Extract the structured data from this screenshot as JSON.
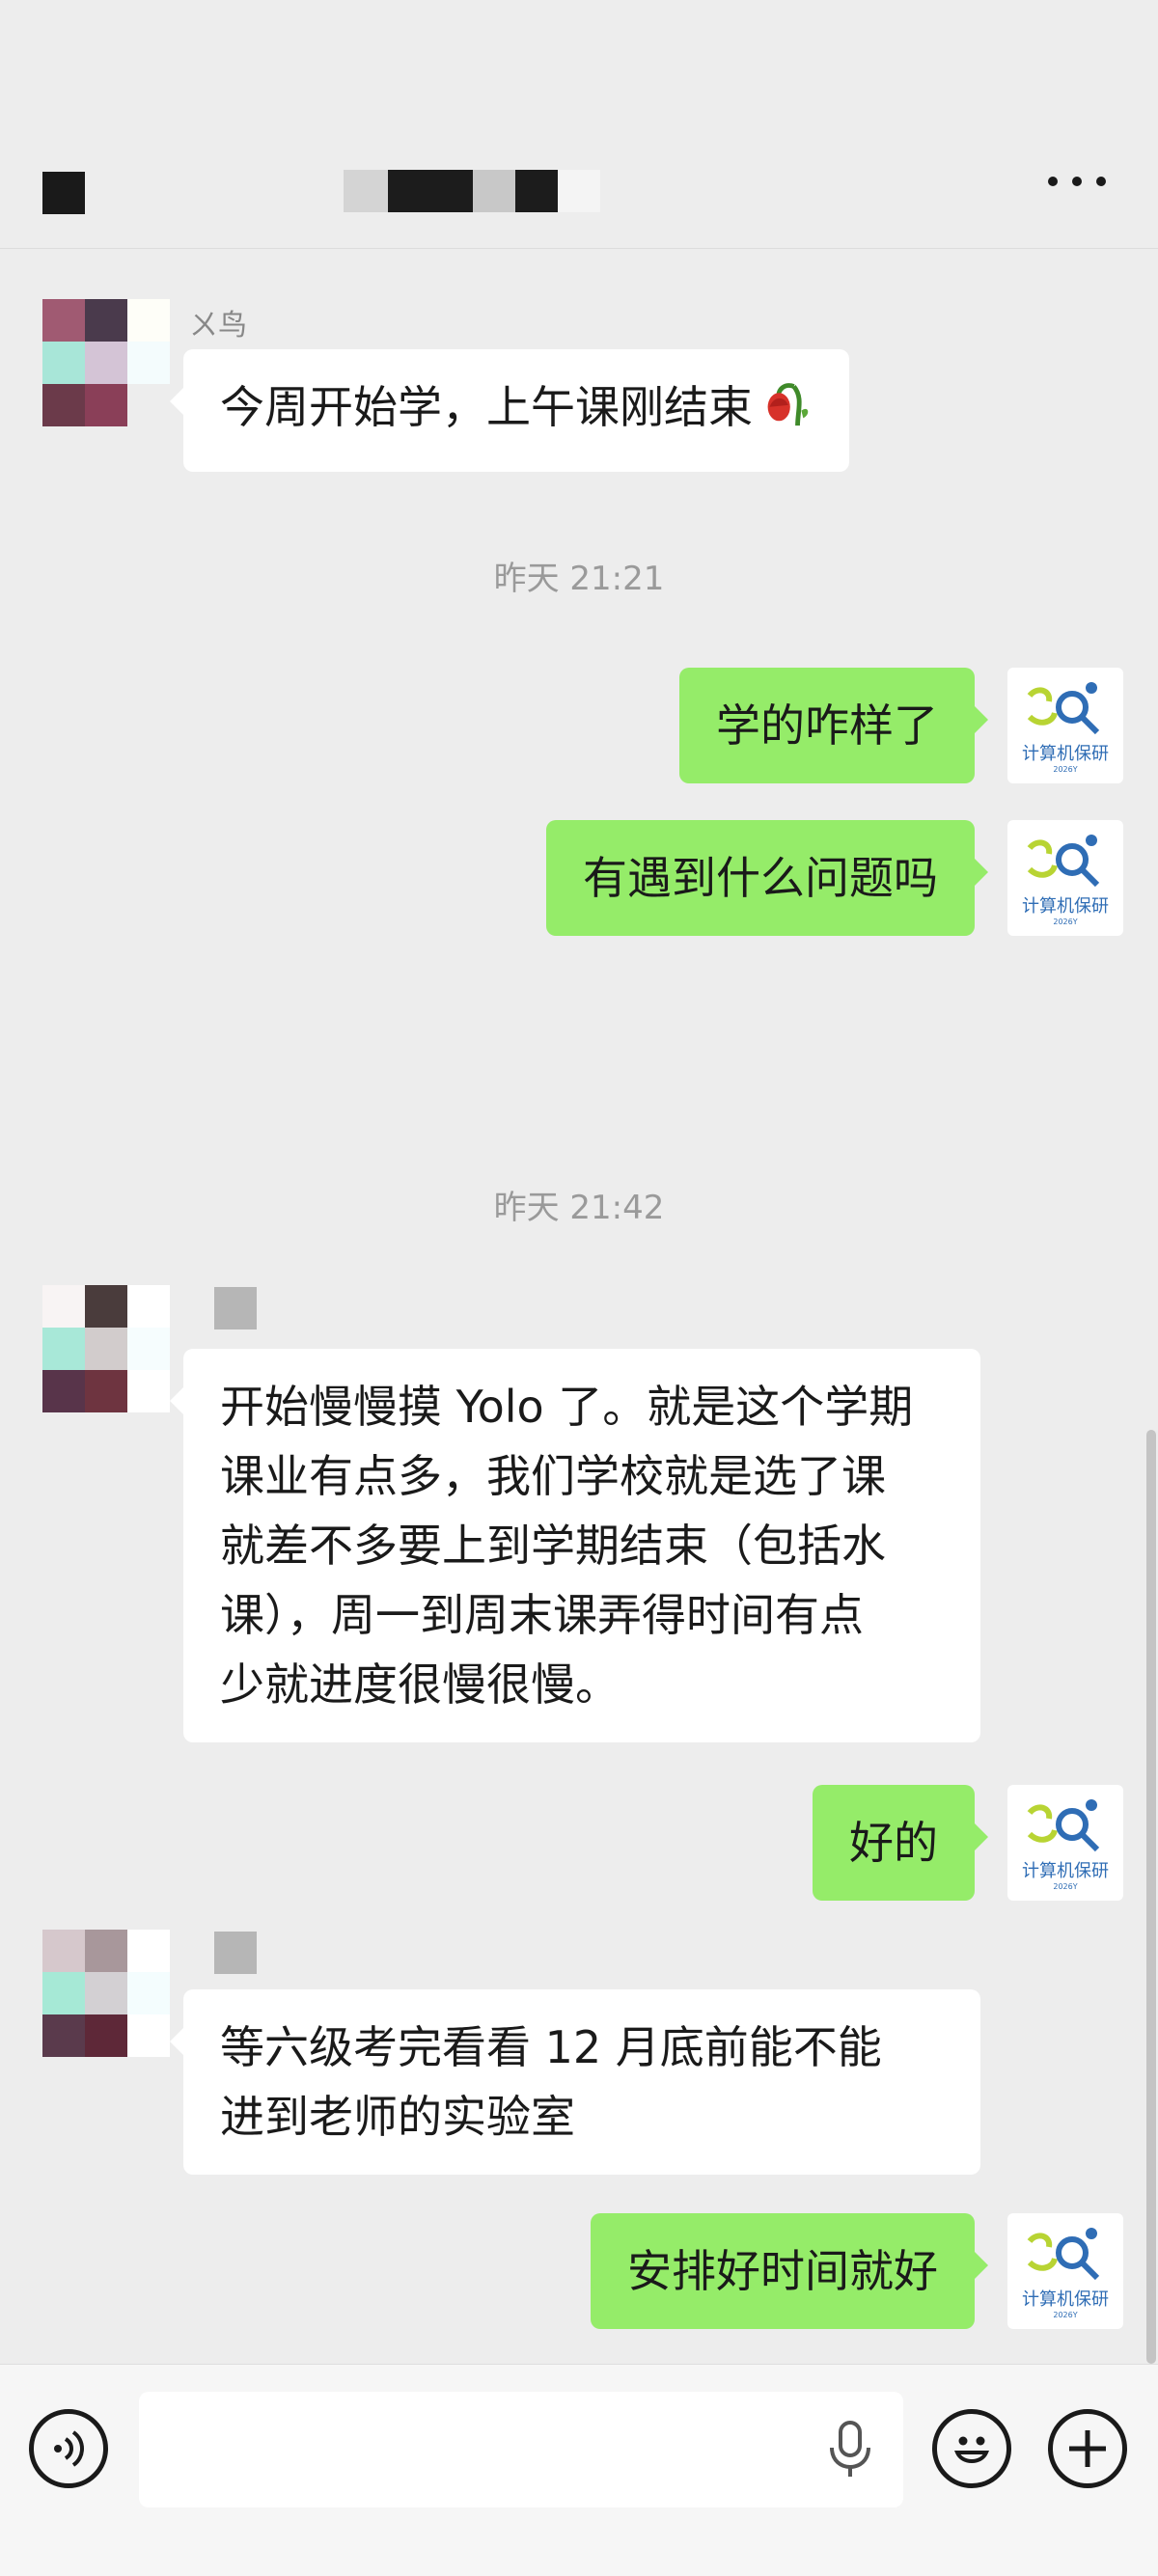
{
  "header": {
    "back_icon": "masked-block",
    "title_masked": true,
    "more_icon": "more-dots-icon"
  },
  "messages": [
    {
      "side": "left",
      "sender": "ㄨ鸟",
      "text": "今周开始学，上午课刚结束",
      "emoji": "wilted-flower-emoji"
    },
    {
      "type": "timestamp",
      "text": "昨天 21:21"
    },
    {
      "side": "right",
      "text": "学的咋样了"
    },
    {
      "side": "right",
      "text": "有遇到什么问题吗"
    },
    {
      "type": "timestamp",
      "text": "昨天 21:42"
    },
    {
      "side": "left",
      "lines": [
        "开始慢慢摸 Yolo 了。就是这个学期",
        "课业有点多，我们学校就是选了课",
        "就差不多要上到学期结束（包括水",
        "课），周一到周末课弄得时间有点",
        "少就进度很慢很慢。"
      ]
    },
    {
      "side": "right",
      "text": "好的"
    },
    {
      "side": "left",
      "lines": [
        "等六级考完看看 12 月底前能不能",
        "进到老师的实验室"
      ]
    },
    {
      "side": "right",
      "text": "安排好时间就好"
    }
  ],
  "my_avatar": {
    "text": "计算机保研",
    "year": "2026Y"
  },
  "input_bar": {
    "voice_icon": "voice-icon",
    "input_value": "",
    "mic_icon": "mic-icon",
    "emoji_icon": "emoji-icon",
    "plus_icon": "plus-icon"
  },
  "colors": {
    "background": "#ededed",
    "bubble_self": "#95ec69",
    "bubble_other": "#ffffff",
    "timestamp": "#9a9a9a"
  }
}
